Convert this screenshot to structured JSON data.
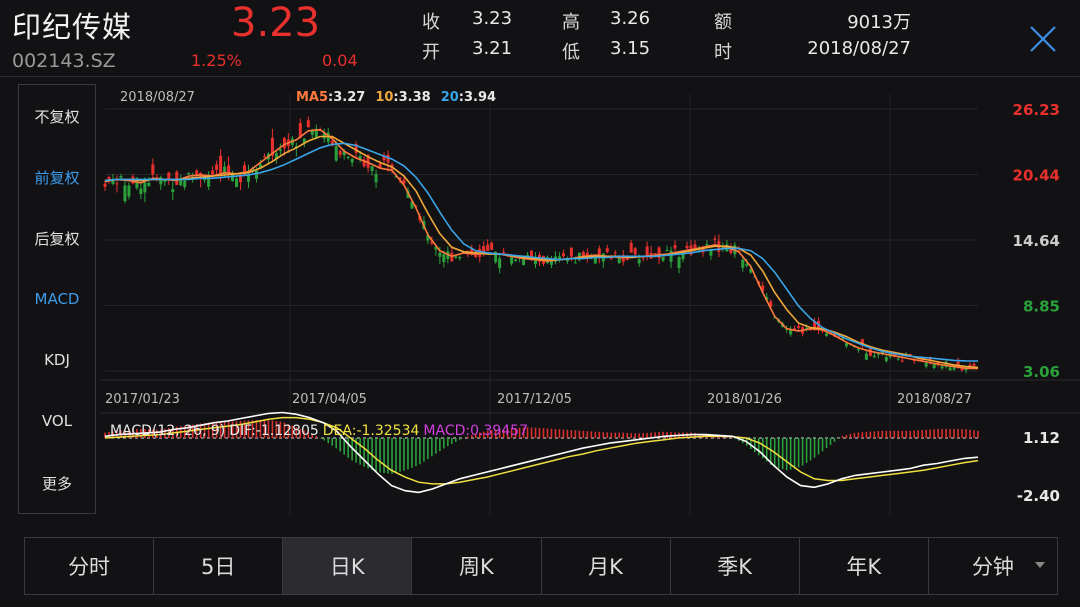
{
  "header": {
    "stock_name": "印纪传媒",
    "stock_code": "002143.SZ",
    "price": "3.23",
    "change_pct": "1.25%",
    "change": "0.04",
    "quote": [
      {
        "label": "收",
        "value": "3.23"
      },
      {
        "label": "高",
        "value": "3.26"
      },
      {
        "label": "额",
        "value": "9013万"
      },
      {
        "label": "开",
        "value": "3.21"
      },
      {
        "label": "低",
        "value": "3.15"
      },
      {
        "label": "时",
        "value": "2018/08/27"
      }
    ],
    "close_icon": "close-icon"
  },
  "left_menu": [
    {
      "label": "不复权",
      "active": false
    },
    {
      "label": "前复权",
      "active": true
    },
    {
      "label": "后复权",
      "active": false
    },
    {
      "label": "MACD",
      "active": true
    },
    {
      "label": "KDJ",
      "active": false
    },
    {
      "label": "VOL",
      "active": false
    },
    {
      "label": "更多",
      "active": false
    }
  ],
  "tabs": [
    {
      "label": "分时"
    },
    {
      "label": "5日"
    },
    {
      "label": "日K"
    },
    {
      "label": "周K"
    },
    {
      "label": "月K"
    },
    {
      "label": "季K"
    },
    {
      "label": "年K"
    },
    {
      "label": "分钟"
    }
  ],
  "active_tab": "日K",
  "chart_data": {
    "type": "line",
    "main": {
      "date_label": "2018/08/27",
      "ma_legend": [
        {
          "name": "MA5",
          "value": "3.27",
          "color": "#ff7a3d"
        },
        {
          "name": "10",
          "value": "3.38",
          "color": "#f0a93a"
        },
        {
          "name": "20",
          "value": "3.94",
          "color": "#3aa5e8"
        }
      ],
      "y_ticks": [
        {
          "label": "26.23",
          "value": 26.23,
          "color": "#e8302d"
        },
        {
          "label": "20.44",
          "value": 20.44,
          "color": "#e8302d"
        },
        {
          "label": "14.64",
          "value": 14.64,
          "color": "#cccccc"
        },
        {
          "label": "8.85",
          "value": 8.85,
          "color": "#2aa13b"
        },
        {
          "label": "3.06",
          "value": 3.06,
          "color": "#2aa13b"
        }
      ],
      "ylim": [
        3.06,
        26.23
      ],
      "x_ticks": [
        "2017/01/23",
        "2017/04/05",
        "2017/12/05",
        "2018/01/26",
        "2018/08/27"
      ],
      "series": [
        {
          "name": "MA5",
          "color": "#ff7a3d",
          "values": [
            19.8,
            20.0,
            19.9,
            19.7,
            20.1,
            20.0,
            19.9,
            20.3,
            20.4,
            20.3,
            20.6,
            20.5,
            20.7,
            21.5,
            22.3,
            23.1,
            23.5,
            24.3,
            24.4,
            23.6,
            22.5,
            21.9,
            21.5,
            21.0,
            20.8,
            19.5,
            17.5,
            15.1,
            13.7,
            13.2,
            13.5,
            13.4,
            13.5,
            13.4,
            13.2,
            13.0,
            12.9,
            12.8,
            12.9,
            13.0,
            13.2,
            13.3,
            13.2,
            13.1,
            13.1,
            13.2,
            13.3,
            13.4,
            13.6,
            13.8,
            14.0,
            14.2,
            14.0,
            13.6,
            12.3,
            10.0,
            7.9,
            6.8,
            6.6,
            6.8,
            6.7,
            6.2,
            5.6,
            5.1,
            4.8,
            4.6,
            4.4,
            4.2,
            4.0,
            3.8,
            3.6,
            3.45,
            3.3,
            3.27
          ]
        },
        {
          "name": "MA10",
          "color": "#f0a93a",
          "values": [
            19.9,
            20.0,
            20.0,
            19.9,
            20.0,
            20.0,
            20.0,
            20.1,
            20.2,
            20.3,
            20.4,
            20.5,
            20.6,
            21.0,
            21.6,
            22.3,
            22.8,
            23.4,
            23.8,
            23.8,
            23.2,
            22.6,
            22.0,
            21.5,
            21.1,
            20.3,
            19.0,
            17.0,
            15.2,
            14.0,
            13.6,
            13.5,
            13.4,
            13.4,
            13.3,
            13.1,
            13.0,
            12.9,
            12.9,
            13.0,
            13.1,
            13.2,
            13.2,
            13.2,
            13.1,
            13.2,
            13.2,
            13.3,
            13.5,
            13.7,
            13.9,
            14.1,
            14.1,
            13.9,
            13.3,
            11.9,
            10.0,
            8.5,
            7.3,
            6.9,
            6.8,
            6.5,
            6.1,
            5.6,
            5.2,
            4.9,
            4.7,
            4.5,
            4.2,
            4.0,
            3.8,
            3.6,
            3.45,
            3.38
          ]
        },
        {
          "name": "MA20",
          "color": "#3aa5e8",
          "values": [
            19.9,
            20.0,
            20.0,
            20.0,
            20.0,
            20.0,
            20.0,
            20.0,
            20.1,
            20.1,
            20.2,
            20.3,
            20.4,
            20.6,
            20.9,
            21.3,
            21.8,
            22.3,
            22.8,
            23.1,
            23.2,
            23.0,
            22.6,
            22.2,
            21.8,
            21.2,
            20.2,
            18.8,
            17.1,
            15.5,
            14.3,
            13.7,
            13.5,
            13.4,
            13.3,
            13.2,
            13.1,
            13.0,
            12.9,
            13.0,
            13.0,
            13.1,
            13.1,
            13.2,
            13.2,
            13.2,
            13.2,
            13.3,
            13.4,
            13.5,
            13.7,
            13.8,
            13.9,
            13.9,
            13.7,
            13.0,
            11.8,
            10.3,
            8.8,
            7.7,
            6.9,
            6.4,
            5.9,
            5.5,
            5.1,
            4.8,
            4.6,
            4.4,
            4.3,
            4.2,
            4.1,
            4.0,
            3.95,
            3.94
          ]
        }
      ]
    },
    "macd": {
      "legend": [
        {
          "text": "MACD(12, 26, 9)",
          "color": "#e8e8e8"
        },
        {
          "text": "DIF:-1.12805",
          "color": "#e8e8e8"
        },
        {
          "text": "DEA:-1.32534",
          "color": "#f0e040"
        },
        {
          "text": "MACD:0.39457",
          "color": "#d040e0"
        }
      ],
      "y_ticks": [
        {
          "label": "1.12",
          "value": 1.12
        },
        {
          "label": "-2.40",
          "value": -2.4
        }
      ],
      "ylim": [
        -3.2,
        1.12
      ],
      "dif": [
        0.1,
        0.2,
        0.25,
        0.3,
        0.35,
        0.5,
        0.6,
        0.75,
        0.9,
        1.0,
        1.15,
        1.3,
        1.45,
        1.5,
        1.4,
        1.2,
        0.9,
        0.4,
        -0.5,
        -1.3,
        -2.1,
        -2.8,
        -3.1,
        -3.2,
        -3.0,
        -2.7,
        -2.4,
        -2.2,
        -2.0,
        -1.8,
        -1.6,
        -1.4,
        -1.2,
        -1.0,
        -0.8,
        -0.6,
        -0.45,
        -0.3,
        -0.2,
        -0.1,
        0.0,
        0.1,
        0.15,
        0.2,
        0.2,
        0.15,
        0.1,
        -0.2,
        -0.8,
        -1.6,
        -2.3,
        -2.8,
        -2.9,
        -2.7,
        -2.4,
        -2.2,
        -2.1,
        -2.0,
        -1.9,
        -1.8,
        -1.6,
        -1.5,
        -1.35,
        -1.2,
        -1.13
      ],
      "dea": [
        0.0,
        0.05,
        0.1,
        0.15,
        0.2,
        0.3,
        0.4,
        0.5,
        0.6,
        0.7,
        0.8,
        0.95,
        1.1,
        1.2,
        1.2,
        1.1,
        0.9,
        0.6,
        0.0,
        -0.6,
        -1.3,
        -1.9,
        -2.3,
        -2.6,
        -2.7,
        -2.7,
        -2.6,
        -2.45,
        -2.3,
        -2.1,
        -1.9,
        -1.7,
        -1.5,
        -1.3,
        -1.1,
        -0.95,
        -0.75,
        -0.6,
        -0.45,
        -0.3,
        -0.2,
        -0.1,
        0.0,
        0.05,
        0.1,
        0.1,
        0.08,
        0.0,
        -0.3,
        -0.8,
        -1.4,
        -2.0,
        -2.4,
        -2.5,
        -2.5,
        -2.4,
        -2.3,
        -2.2,
        -2.1,
        -2.0,
        -1.9,
        -1.75,
        -1.6,
        -1.45,
        -1.33
      ],
      "hist": [
        0.3,
        0.4,
        0.5,
        0.5,
        0.45,
        0.6,
        0.7,
        0.8,
        0.9,
        0.9,
        0.95,
        1.0,
        1.0,
        0.9,
        0.6,
        0.3,
        -0.1,
        -0.6,
        -1.2,
        -1.6,
        -1.9,
        -2.0,
        -1.8,
        -1.5,
        -1.0,
        -0.5,
        -0.1,
        0.2,
        0.4,
        0.5,
        0.55,
        0.6,
        0.55,
        0.5,
        0.45,
        0.4,
        0.35,
        0.3,
        0.3,
        0.25,
        0.3,
        0.35,
        0.3,
        0.3,
        0.2,
        0.1,
        0.05,
        -0.4,
        -1.0,
        -1.6,
        -1.8,
        -1.6,
        -1.1,
        -0.5,
        0.1,
        0.3,
        0.35,
        0.4,
        0.4,
        0.4,
        0.45,
        0.5,
        0.5,
        0.5,
        0.4
      ]
    }
  }
}
